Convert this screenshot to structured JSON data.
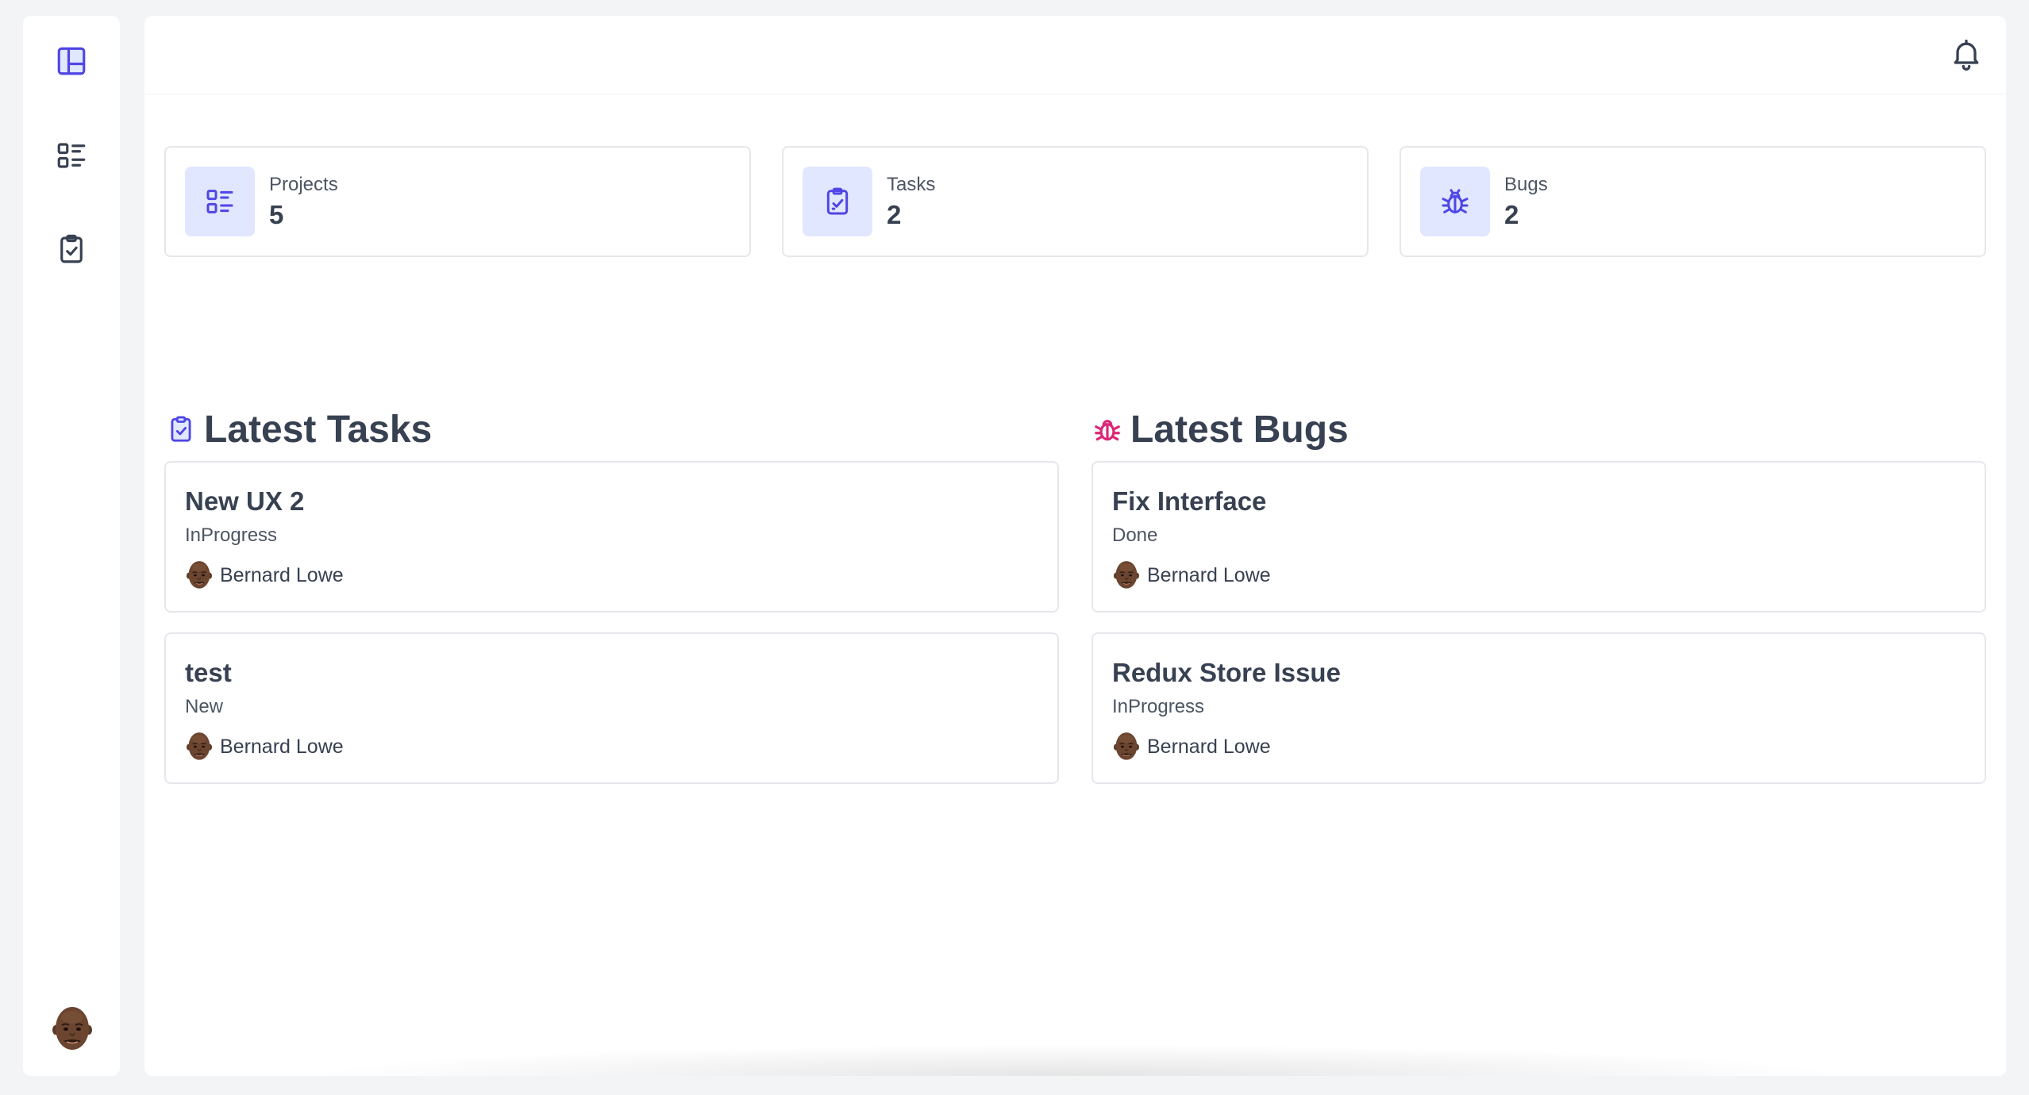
{
  "sidebar": {
    "items": [
      {
        "icon": "dashboard-icon",
        "active": true
      },
      {
        "icon": "projects-list-icon",
        "active": false
      },
      {
        "icon": "tasks-clipboard-icon",
        "active": false
      }
    ],
    "user_avatar": "user-avatar"
  },
  "header": {
    "notifications_icon": "bell-icon"
  },
  "stats": {
    "projects": {
      "label": "Projects",
      "value": "5"
    },
    "tasks": {
      "label": "Tasks",
      "value": "2"
    },
    "bugs": {
      "label": "Bugs",
      "value": "2"
    }
  },
  "latest_tasks": {
    "title": "Latest Tasks",
    "items": [
      {
        "title": "New UX 2",
        "status": "InProgress",
        "assignee": "Bernard Lowe"
      },
      {
        "title": "test",
        "status": "New",
        "assignee": "Bernard Lowe"
      }
    ]
  },
  "latest_bugs": {
    "title": "Latest Bugs",
    "items": [
      {
        "title": "Fix Interface",
        "status": "Done",
        "assignee": "Bernard Lowe"
      },
      {
        "title": "Redux Store Issue",
        "status": "InProgress",
        "assignee": "Bernard Lowe"
      }
    ]
  },
  "colors": {
    "accent": "#4f46e5",
    "accent_bg": "#e0e7ff",
    "bug_accent": "#db2777",
    "text": "#374151"
  }
}
